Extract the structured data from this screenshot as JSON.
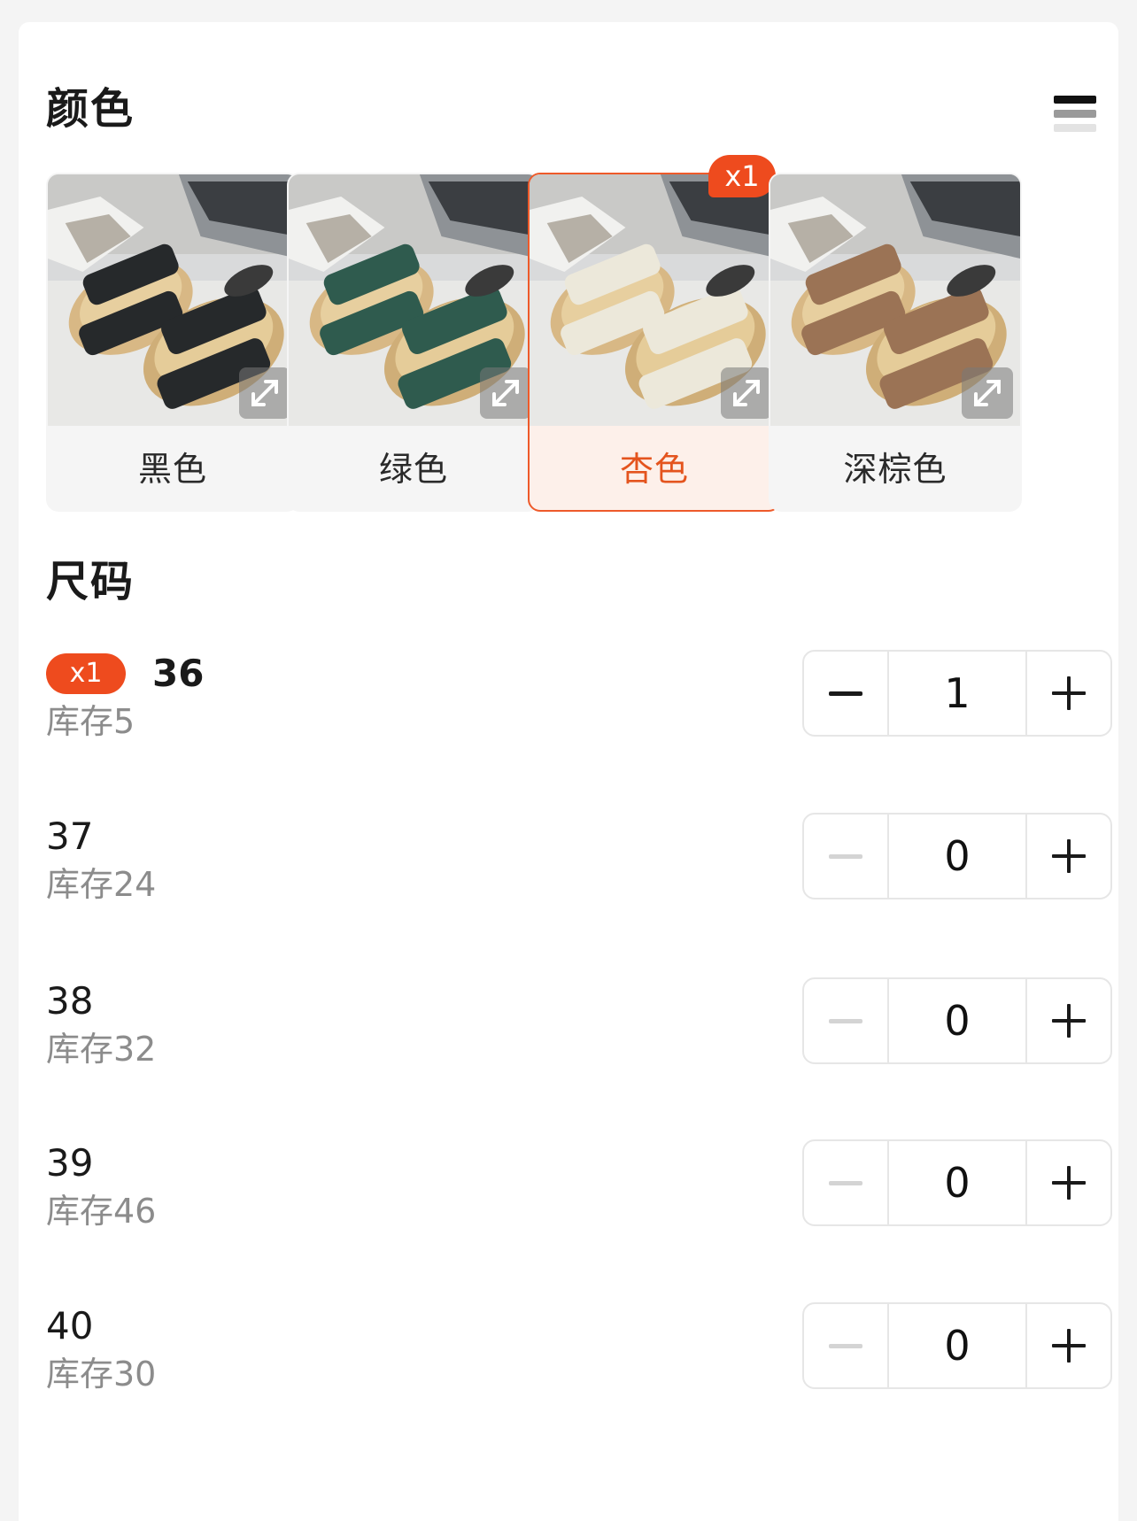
{
  "sections": {
    "color_title": "颜色",
    "size_title": "尺码"
  },
  "colors": [
    {
      "label": "黑色",
      "strap": "#26292b",
      "selected": false,
      "count_badge": ""
    },
    {
      "label": "绿色",
      "strap": "#2f5b4e",
      "selected": false,
      "count_badge": ""
    },
    {
      "label": "杏色",
      "strap": "#ece8da",
      "selected": true,
      "count_badge": "x1"
    },
    {
      "label": "深棕色",
      "strap": "#9b7355",
      "selected": false,
      "count_badge": ""
    }
  ],
  "sizes": [
    {
      "size": "36",
      "stock": "库存5",
      "qty": "1",
      "badge": "x1"
    },
    {
      "size": "37",
      "stock": "库存24",
      "qty": "0",
      "badge": ""
    },
    {
      "size": "38",
      "stock": "库存32",
      "qty": "0",
      "badge": ""
    },
    {
      "size": "39",
      "stock": "库存46",
      "qty": "0",
      "badge": ""
    },
    {
      "size": "40",
      "stock": "库存30",
      "qty": "0",
      "badge": ""
    }
  ],
  "icons": {
    "layout_toggle": "list-layout-icon",
    "expand": "expand-icon",
    "minus": "minus-icon",
    "plus": "plus-icon"
  },
  "theme": {
    "accent": "#ee4b1e",
    "selected_bg": "#fdf0ea"
  }
}
